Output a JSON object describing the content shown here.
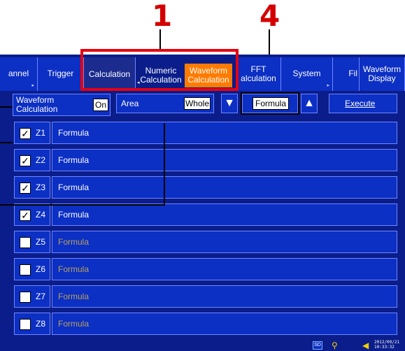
{
  "callouts": {
    "top_left": "1",
    "top_right": "4"
  },
  "tabs": [
    {
      "label": "annel"
    },
    {
      "label": "Trigger"
    },
    {
      "label": "Calculation"
    },
    {
      "label": "Numeric Calculation"
    },
    {
      "label": "Waveform Calculation"
    },
    {
      "label": "FFT alculation"
    },
    {
      "label": "System"
    },
    {
      "label": "Fil"
    },
    {
      "label": "Waveform Display"
    }
  ],
  "controls": {
    "waveform_calc_label": "Waveform\nCalculation",
    "waveform_calc_value": "On",
    "area_label": "Area",
    "area_value": "Whole",
    "formula_button": "Formula",
    "execute_button": "Execute"
  },
  "rows": [
    {
      "z": "Z1",
      "checked": "✓",
      "formula": "Formula"
    },
    {
      "z": "Z2",
      "checked": "✓",
      "formula": "Formula"
    },
    {
      "z": "Z3",
      "checked": "✓",
      "formula": "Formula"
    },
    {
      "z": "Z4",
      "checked": "✓",
      "formula": "Formula"
    },
    {
      "z": "Z5",
      "checked": "",
      "formula": "Formula"
    },
    {
      "z": "Z6",
      "checked": "",
      "formula": "Formula"
    },
    {
      "z": "Z7",
      "checked": "",
      "formula": "Formula"
    },
    {
      "z": "Z8",
      "checked": "",
      "formula": "Formula"
    }
  ],
  "status": {
    "sd": "SD",
    "datetime": "2012/09/21\n10:33:32"
  },
  "icons": {
    "down": "down-triangle-icon",
    "up": "up-triangle-icon",
    "check": "check-icon",
    "sd": "sd-card-icon",
    "usb": "usb-icon",
    "plug": "power-plug-icon"
  },
  "colors": {
    "background": "#0a1d8a",
    "tab": "#0c2fc4",
    "active_subtab": "#ff7b00",
    "callout_red": "#d40000",
    "disabled_formula": "#b9a15a"
  }
}
